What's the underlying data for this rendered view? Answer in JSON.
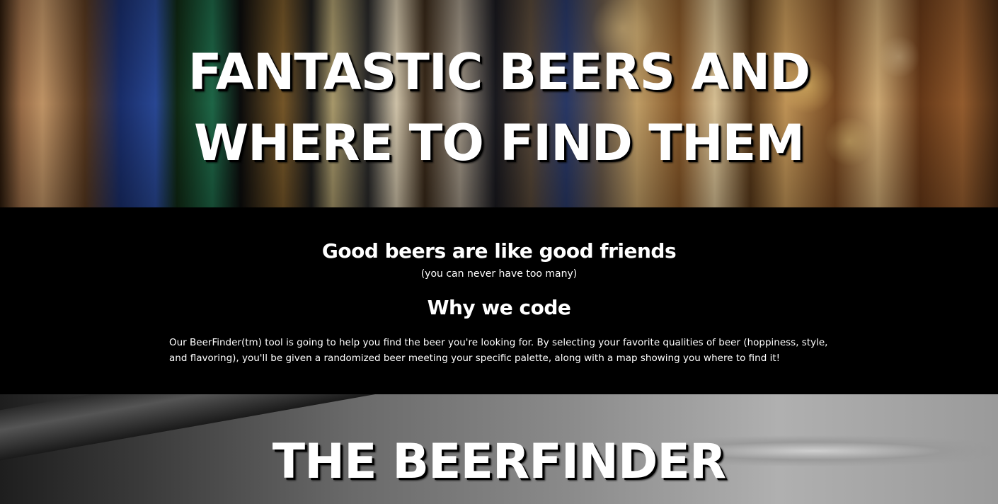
{
  "hero": {
    "title_line1": "FANTASTIC BEERS AND",
    "title_line2": "WHERE TO FIND THEM"
  },
  "about": {
    "heading": "Good beers are like good friends",
    "subheading": "(you can never have too many)"
  },
  "why": {
    "heading": "Why we code",
    "body": "Our BeerFinder(tm) tool is going to help you find the beer you're looking for. By selecting your favorite qualities of beer (hoppiness, style, and flavoring), you'll be given a randomized beer meeting your specific palette, along with a map showing you where to find it!"
  },
  "finder": {
    "title": "THE BEERFINDER"
  }
}
